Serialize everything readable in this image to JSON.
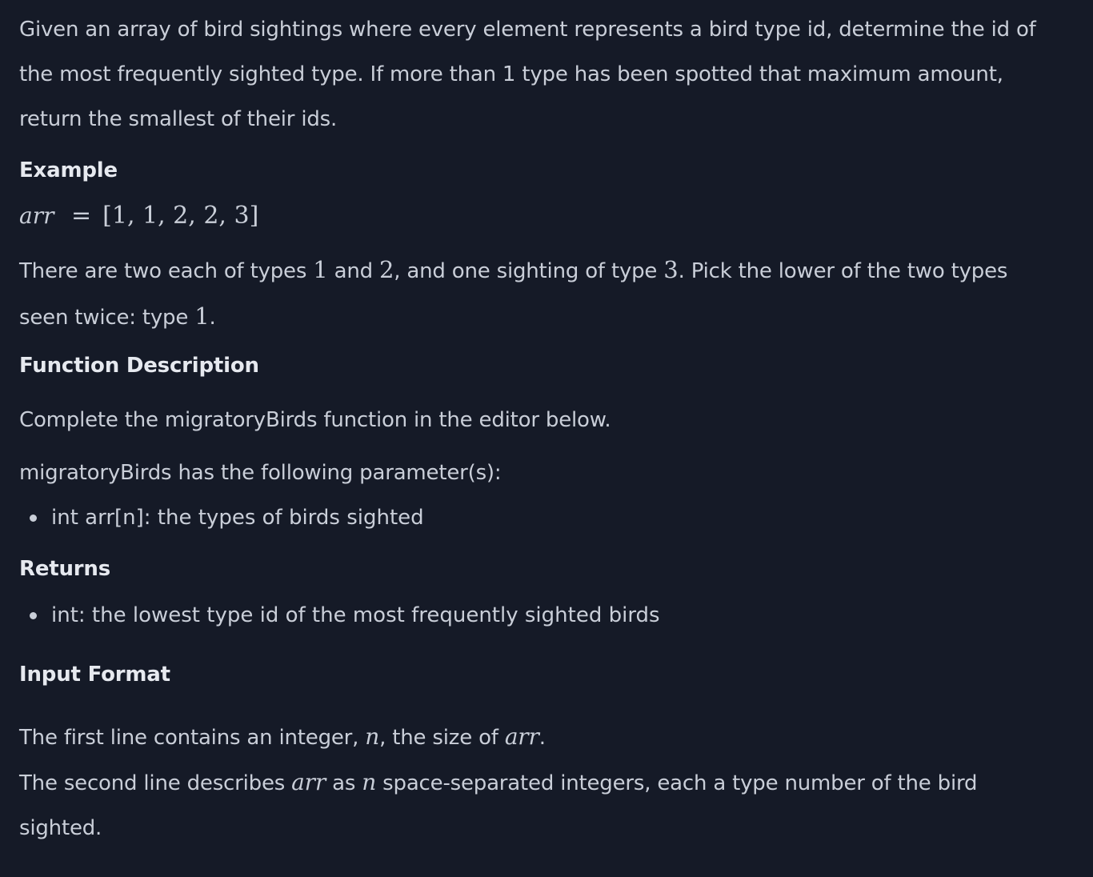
{
  "intro": {
    "line1": "Given an array of bird sightings where every element represents a bird type id, determine the id of",
    "line2": "the most frequently sighted type. If more than 1 type has been spotted that maximum amount,",
    "line3": "return the smallest of their ids."
  },
  "example": {
    "heading": "Example",
    "array_var": "arr",
    "equals": "=",
    "array_values": "[1, 1, 2, 2, 3]",
    "explanation": {
      "t1": "There are two each of types ",
      "n1": "1",
      "t2": " and ",
      "n2": "2",
      "t3": ", and one sighting of type ",
      "n3": "3",
      "t4": ". Pick the lower of the two types",
      "t5": "seen twice: type ",
      "n4": "1",
      "t6": "."
    }
  },
  "function_description": {
    "heading": "Function Description",
    "text": "Complete the migratoryBirds function in the editor below.",
    "params_intro": "migratoryBirds has the following parameter(s):",
    "params": [
      "int arr[n]: the types of birds sighted"
    ]
  },
  "returns": {
    "heading": "Returns",
    "items": [
      "int: the lowest type id of the most frequently sighted birds"
    ]
  },
  "input_format": {
    "heading": "Input Format",
    "line1": {
      "t1": "The first line contains an integer, ",
      "v1": "n",
      "t2": ", the size of ",
      "v2": "arr",
      "t3": "."
    },
    "line2": {
      "t1": "The second line describes ",
      "v1": "arr",
      "t2": " as ",
      "v2": "n",
      "t3": " space-separated integers, each a type number of the bird",
      "t4": "sighted."
    }
  },
  "colors": {
    "background": "#151a27",
    "text": "#c9ced8",
    "heading": "#e6e9ef"
  }
}
